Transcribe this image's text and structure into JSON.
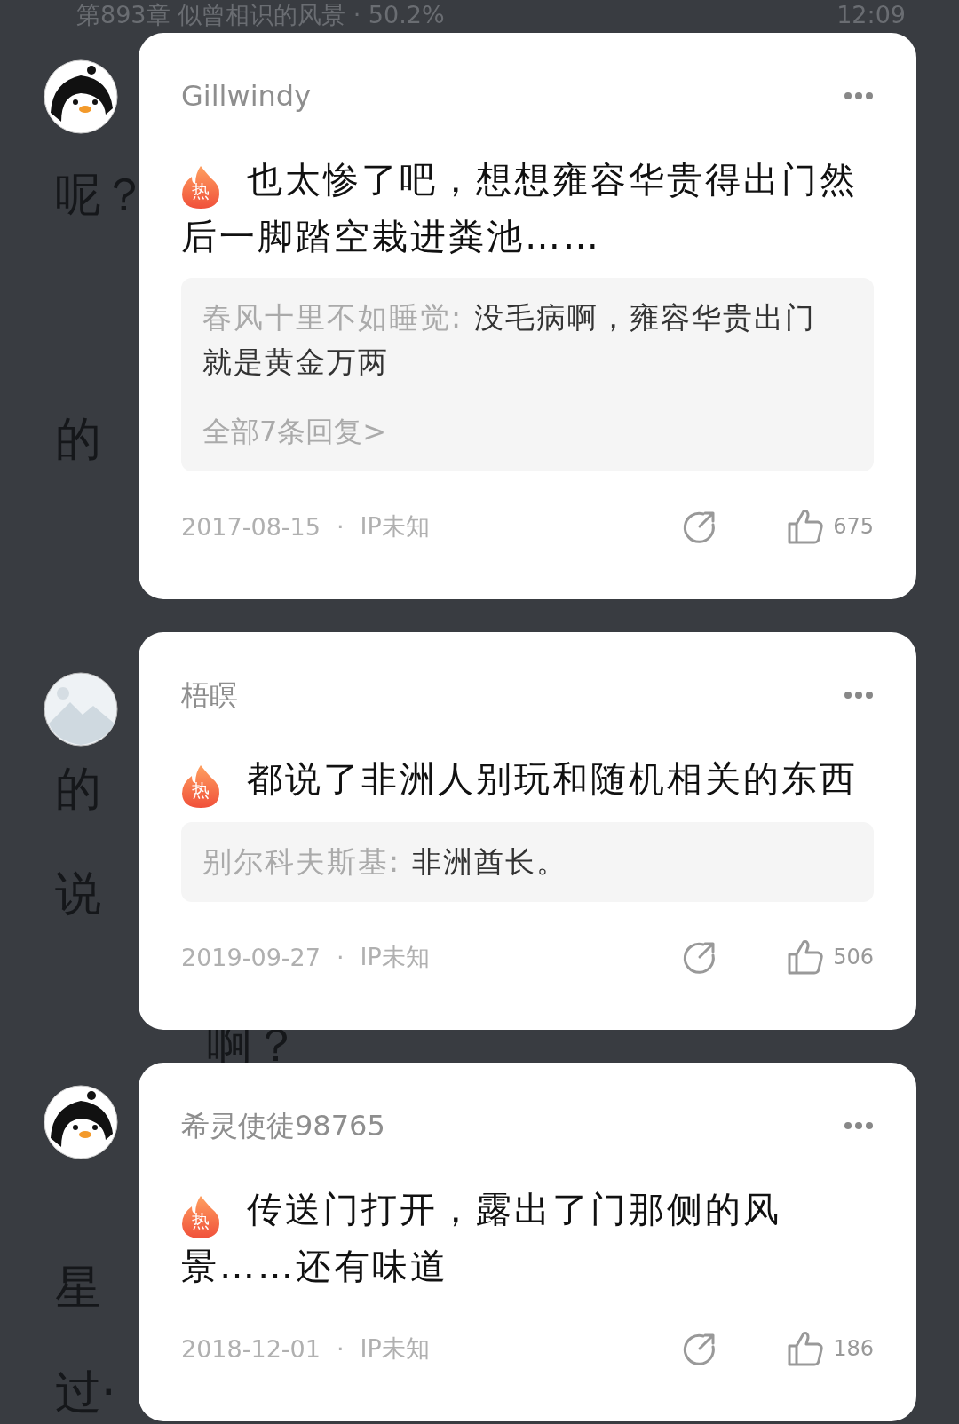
{
  "reader_page": {
    "header": {
      "chapter": "第893章 似曾相识的风景 · 50.2%",
      "time": "12:09"
    },
    "items": [
      {
        "kind": "penguin"
      },
      {
        "kind": "text",
        "text": "呢？"
      },
      {
        "kind": "text",
        "text": "的"
      },
      {
        "kind": "photo"
      },
      {
        "kind": "text",
        "text": "的"
      },
      {
        "kind": "text",
        "text": "说"
      },
      {
        "kind": "text",
        "text": "啊？"
      },
      {
        "kind": "penguin"
      },
      {
        "kind": "text",
        "text": "星"
      },
      {
        "kind": "text",
        "text": "过·"
      }
    ]
  },
  "comments": [
    {
      "author": "Gillwindy",
      "badge": "热",
      "text": "也太惨了吧，想想雍容华贵得出门然后一脚踏空栽进粪池……",
      "reply": {
        "author": "春风十里不如睡觉:",
        "text": "没毛病啊，雍容华贵出门就是黄金万两",
        "more": "全部7条回复>"
      },
      "date": "2017-08-15",
      "separator": "·",
      "ip": "IP未知",
      "likes": "675"
    },
    {
      "author": "梧瞑",
      "badge": "热",
      "text": "都说了非洲人别玩和随机相关的东西",
      "reply": {
        "author": "别尔科夫斯基:",
        "text": "非洲酋长。"
      },
      "date": "2019-09-27",
      "separator": "·",
      "ip": "IP未知",
      "likes": "506"
    },
    {
      "author": "希灵使徒98765",
      "badge": "热",
      "text": "传送门打开，露出了门那侧的风景……还有味道",
      "date": "2018-12-01",
      "separator": "·",
      "ip": "IP未知",
      "likes": "186"
    }
  ]
}
